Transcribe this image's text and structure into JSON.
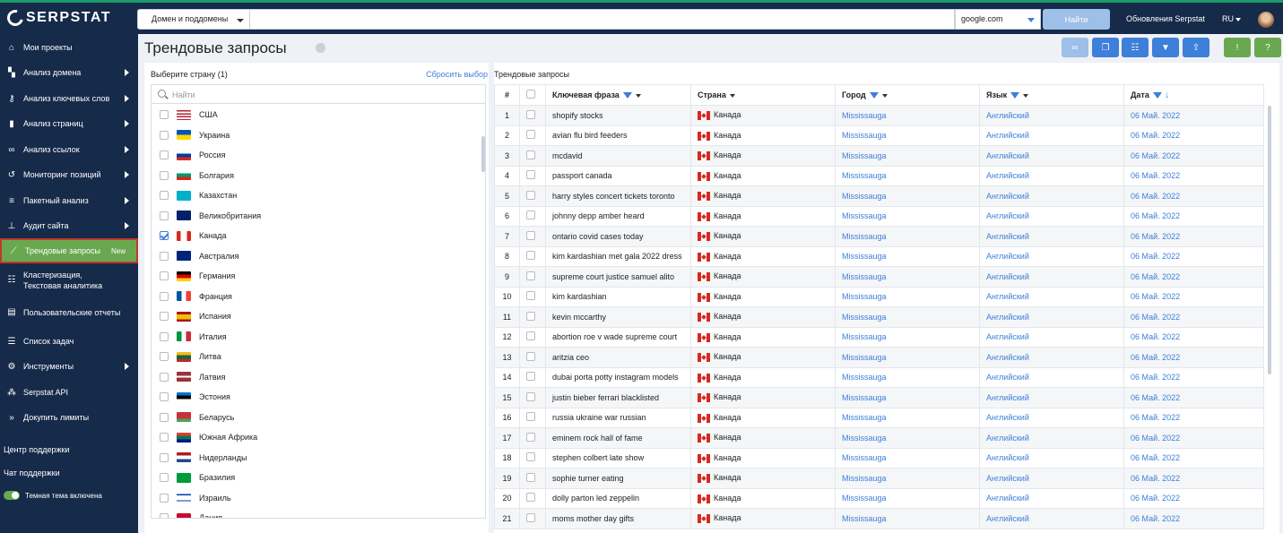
{
  "header": {
    "logo": "SERPSTAT",
    "search_type": "Домен и поддомены",
    "search_value": "",
    "engine": "google.com",
    "find_label": "Найти",
    "updates_label": "Обновления Serpstat",
    "lang": "RU"
  },
  "sidebar": {
    "items": [
      {
        "label": "Мои проекты",
        "icon": "home-icon",
        "arrow": false
      },
      {
        "label": "Анализ домена",
        "icon": "domain-chart-icon",
        "arrow": true
      },
      {
        "label": "Анализ ключевых слов",
        "icon": "key-icon",
        "arrow": true
      },
      {
        "label": "Анализ страниц",
        "icon": "bar-chart-icon",
        "arrow": true
      },
      {
        "label": "Анализ ссылок",
        "icon": "link-icon",
        "arrow": true
      },
      {
        "label": "Мониторинг позиций",
        "icon": "history-icon",
        "arrow": true
      },
      {
        "label": "Пакетный анализ",
        "icon": "database-icon",
        "arrow": true
      },
      {
        "label": "Аудит сайта",
        "icon": "sitemap-icon",
        "arrow": true
      },
      {
        "label": "Трендовые запросы",
        "icon": "trend-icon",
        "badge": "New",
        "active": true
      },
      {
        "label": "Кластеризация, Текстовая аналитика",
        "icon": "cluster-icon",
        "two_line": true
      },
      {
        "label": "Пользовательские отчеты",
        "icon": "report-icon",
        "two_line": true
      },
      {
        "label": "Список задач",
        "icon": "list-icon"
      },
      {
        "label": "Инструменты",
        "icon": "gear-icon",
        "arrow": true
      },
      {
        "label": "Serpstat API",
        "icon": "api-icon"
      },
      {
        "label": "Докупить лимиты",
        "icon": "limits-icon"
      }
    ],
    "support_center": "Центр поддержки",
    "support_chat": "Чат поддержки",
    "dark_theme": "Темная тема включена"
  },
  "page": {
    "title": "Трендовые запросы"
  },
  "toolbar": {
    "buttons": [
      {
        "name": "link-button",
        "icon": "link-icon",
        "color": "#9dbfe8"
      },
      {
        "name": "copy-button",
        "icon": "copy-icon",
        "color": "#3d7fd9"
      },
      {
        "name": "columns-button",
        "icon": "columns-icon",
        "color": "#3d7fd9"
      },
      {
        "name": "filter-button",
        "icon": "filter-icon",
        "color": "#3d7fd9"
      },
      {
        "name": "export-button",
        "icon": "upload-icon",
        "color": "#3d7fd9"
      },
      {
        "name": "feedback-button",
        "icon": "feedback-icon",
        "color": "#6aa84f"
      },
      {
        "name": "help-button",
        "icon": "question-icon",
        "color": "#6aa84f"
      }
    ]
  },
  "countries": {
    "header": "Выберите страну (1)",
    "reset": "Сбросить выбор",
    "search_placeholder": "Найти",
    "items": [
      {
        "name": "США",
        "flag": "us"
      },
      {
        "name": "Украина",
        "flag": "ua"
      },
      {
        "name": "Россия",
        "flag": "ru"
      },
      {
        "name": "Болгария",
        "flag": "bg"
      },
      {
        "name": "Казахстан",
        "flag": "kz"
      },
      {
        "name": "Великобритания",
        "flag": "gb"
      },
      {
        "name": "Канада",
        "flag": "ca",
        "checked": true
      },
      {
        "name": "Австралия",
        "flag": "au"
      },
      {
        "name": "Германия",
        "flag": "de"
      },
      {
        "name": "Франция",
        "flag": "fr"
      },
      {
        "name": "Испания",
        "flag": "es"
      },
      {
        "name": "Италия",
        "flag": "it"
      },
      {
        "name": "Литва",
        "flag": "lt"
      },
      {
        "name": "Латвия",
        "flag": "lv"
      },
      {
        "name": "Эстония",
        "flag": "ee"
      },
      {
        "name": "Беларусь",
        "flag": "by"
      },
      {
        "name": "Южная Африка",
        "flag": "za"
      },
      {
        "name": "Нидерланды",
        "flag": "nl"
      },
      {
        "name": "Бразилия",
        "flag": "br"
      },
      {
        "name": "Израиль",
        "flag": "il"
      },
      {
        "name": "Дания",
        "flag": "dk"
      }
    ]
  },
  "trends": {
    "header": "Трендовые запросы",
    "columns": {
      "num": "#",
      "keyword": "Ключевая фраза",
      "country": "Страна",
      "city": "Город",
      "language": "Язык",
      "date": "Дата"
    },
    "rows": [
      {
        "n": "1",
        "keyword": "shopify stocks",
        "country": "Канада",
        "city": "Mississauga",
        "language": "Английский",
        "date": "06 Май. 2022"
      },
      {
        "n": "2",
        "keyword": "avian flu bird feeders",
        "country": "Канада",
        "city": "Mississauga",
        "language": "Английский",
        "date": "06 Май. 2022"
      },
      {
        "n": "3",
        "keyword": "mcdavid",
        "country": "Канада",
        "city": "Mississauga",
        "language": "Английский",
        "date": "06 Май. 2022"
      },
      {
        "n": "4",
        "keyword": "passport canada",
        "country": "Канада",
        "city": "Mississauga",
        "language": "Английский",
        "date": "06 Май. 2022"
      },
      {
        "n": "5",
        "keyword": "harry styles concert tickets toronto",
        "country": "Канада",
        "city": "Mississauga",
        "language": "Английский",
        "date": "06 Май. 2022"
      },
      {
        "n": "6",
        "keyword": "johnny depp amber heard",
        "country": "Канада",
        "city": "Mississauga",
        "language": "Английский",
        "date": "06 Май. 2022"
      },
      {
        "n": "7",
        "keyword": "ontario covid cases today",
        "country": "Канада",
        "city": "Mississauga",
        "language": "Английский",
        "date": "06 Май. 2022"
      },
      {
        "n": "8",
        "keyword": "kim kardashian met gala 2022 dress",
        "country": "Канада",
        "city": "Mississauga",
        "language": "Английский",
        "date": "06 Май. 2022"
      },
      {
        "n": "9",
        "keyword": "supreme court justice samuel alito",
        "country": "Канада",
        "city": "Mississauga",
        "language": "Английский",
        "date": "06 Май. 2022"
      },
      {
        "n": "10",
        "keyword": "kim kardashian",
        "country": "Канада",
        "city": "Mississauga",
        "language": "Английский",
        "date": "06 Май. 2022"
      },
      {
        "n": "11",
        "keyword": "kevin mccarthy",
        "country": "Канада",
        "city": "Mississauga",
        "language": "Английский",
        "date": "06 Май. 2022"
      },
      {
        "n": "12",
        "keyword": "abortion roe v wade supreme court",
        "country": "Канада",
        "city": "Mississauga",
        "language": "Английский",
        "date": "06 Май. 2022"
      },
      {
        "n": "13",
        "keyword": "aritzia ceo",
        "country": "Канада",
        "city": "Mississauga",
        "language": "Английский",
        "date": "06 Май. 2022"
      },
      {
        "n": "14",
        "keyword": "dubai porta potty instagram models",
        "country": "Канада",
        "city": "Mississauga",
        "language": "Английский",
        "date": "06 Май. 2022"
      },
      {
        "n": "15",
        "keyword": "justin bieber ferrari blacklisted",
        "country": "Канада",
        "city": "Mississauga",
        "language": "Английский",
        "date": "06 Май. 2022"
      },
      {
        "n": "16",
        "keyword": "russia ukraine war russian",
        "country": "Канада",
        "city": "Mississauga",
        "language": "Английский",
        "date": "06 Май. 2022"
      },
      {
        "n": "17",
        "keyword": "eminem rock hall of fame",
        "country": "Канада",
        "city": "Mississauga",
        "language": "Английский",
        "date": "06 Май. 2022"
      },
      {
        "n": "18",
        "keyword": "stephen colbert late show",
        "country": "Канада",
        "city": "Mississauga",
        "language": "Английский",
        "date": "06 Май. 2022"
      },
      {
        "n": "19",
        "keyword": "sophie turner eating",
        "country": "Канада",
        "city": "Mississauga",
        "language": "Английский",
        "date": "06 Май. 2022"
      },
      {
        "n": "20",
        "keyword": "dolly parton led zeppelin",
        "country": "Канада",
        "city": "Mississauga",
        "language": "Английский",
        "date": "06 Май. 2022"
      },
      {
        "n": "21",
        "keyword": "moms mother day gifts",
        "country": "Канада",
        "city": "Mississauga",
        "language": "Английский",
        "date": "06 Май. 2022"
      }
    ]
  }
}
